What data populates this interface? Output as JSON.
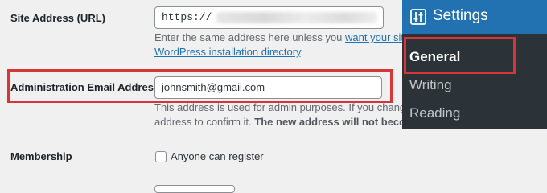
{
  "site_address": {
    "label": "Site Address (URL)",
    "value": "https://",
    "description_before": "Enter the same address here unless you ",
    "description_link": "want your site home page",
    "description_line2_link": "WordPress installation directory",
    "description_line2_after": "."
  },
  "admin_email": {
    "label": "Administration Email Address",
    "value": "johnsmith@gmail.com",
    "description_line1": "This address is used for admin purposes. If you change this, an",
    "description_line2_normal": "address to confirm it. ",
    "description_line2_bold": "The new address will not become activ"
  },
  "membership": {
    "label": "Membership",
    "checkbox_label": "Anyone can register",
    "checked": false
  },
  "admin_menu": {
    "title": "Settings",
    "icon": "settings-sliders-icon",
    "items": [
      {
        "label": "General",
        "current": true
      },
      {
        "label": "Writing",
        "current": false
      },
      {
        "label": "Reading",
        "current": false
      }
    ]
  },
  "colors": {
    "highlight": "#d63638",
    "menu_bg": "#2c3338",
    "menu_active": "#2271b1",
    "link": "#2271b1"
  }
}
